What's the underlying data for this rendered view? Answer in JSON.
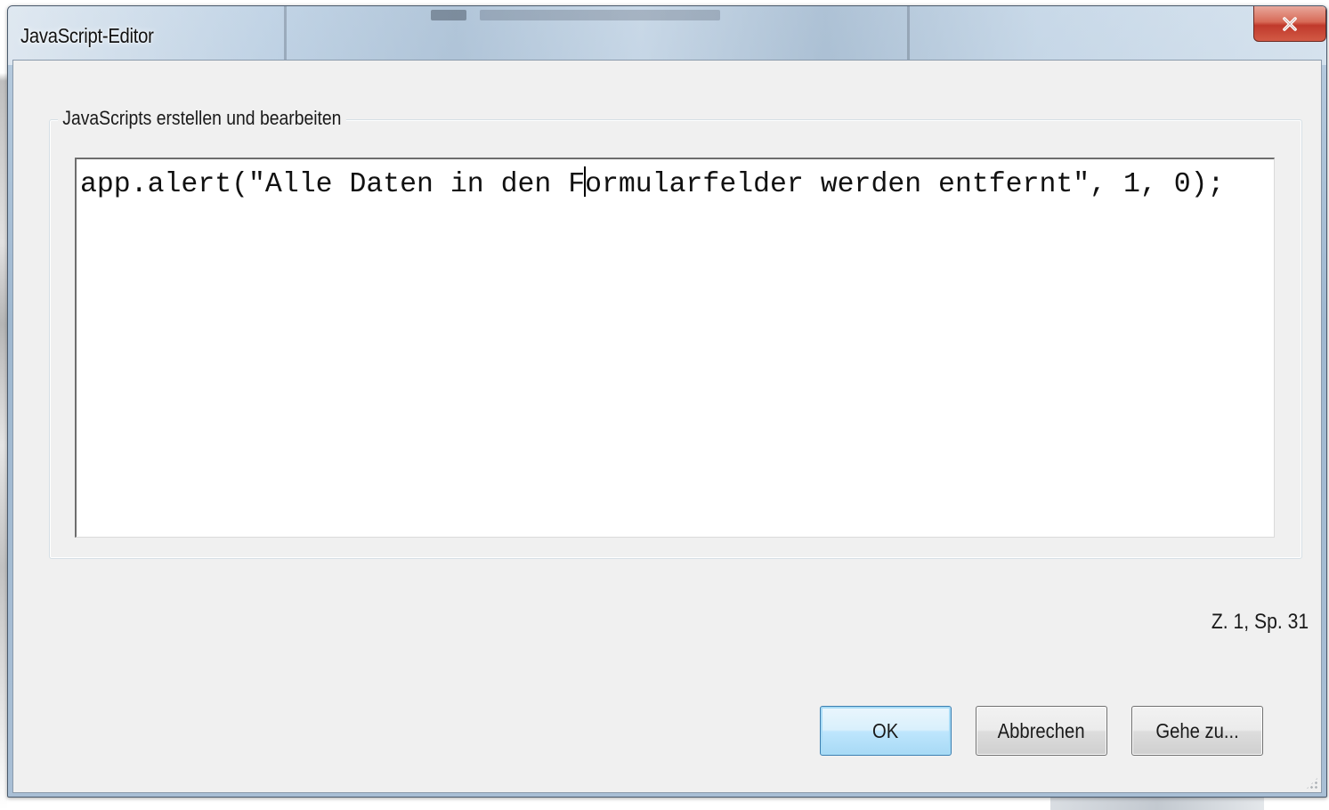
{
  "window": {
    "title": "JavaScript-Editor",
    "close_label": "X"
  },
  "group": {
    "label": "JavaScripts erstellen und bearbeiten"
  },
  "editor": {
    "code_before_caret": "app.alert(\"Alle Daten in den F",
    "code_after_caret": "ormularfelder werden entfernt\", 1, 0);"
  },
  "status": {
    "position": "Z. 1, Sp. 31"
  },
  "buttons": {
    "ok": "OK",
    "cancel": "Abbrechen",
    "goto": "Gehe zu..."
  },
  "colors": {
    "default_button_border": "#3c7fb1",
    "close_button": "#c0392b",
    "client_background": "#f0f0f0"
  }
}
